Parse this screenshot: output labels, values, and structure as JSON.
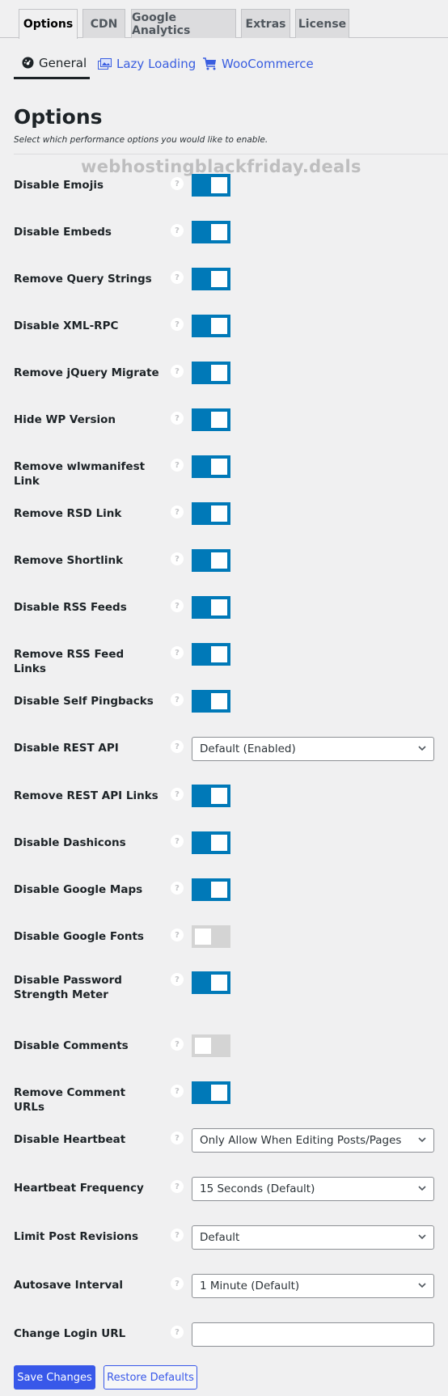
{
  "tabs": [
    {
      "label": "Options",
      "active": true
    },
    {
      "label": "CDN",
      "active": false
    },
    {
      "label": "Google Analytics",
      "active": false
    },
    {
      "label": "Extras",
      "active": false
    },
    {
      "label": "License",
      "active": false
    }
  ],
  "subtabs": [
    {
      "label": "General",
      "icon": "dashboard-icon",
      "active": true
    },
    {
      "label": "Lazy Loading",
      "icon": "images-icon",
      "active": false
    },
    {
      "label": "WooCommerce",
      "icon": "cart-icon",
      "active": false
    }
  ],
  "heading": "Options",
  "subtitle": "Select which performance options you would like to enable.",
  "watermark": "webhostingblackfriday.deals",
  "help_glyph": "?",
  "colors": {
    "toggle_on": "#0079b8",
    "toggle_off": "#d4d4d4",
    "primary": "#3858e9",
    "link": "#3a5ee0"
  },
  "options": [
    {
      "label": "Disable Emojis",
      "type": "toggle",
      "value": true
    },
    {
      "label": "Disable Embeds",
      "type": "toggle",
      "value": true
    },
    {
      "label": "Remove Query Strings",
      "type": "toggle",
      "value": true
    },
    {
      "label": "Disable XML-RPC",
      "type": "toggle",
      "value": true
    },
    {
      "label": "Remove jQuery Migrate",
      "type": "toggle",
      "value": true
    },
    {
      "label": "Hide WP Version",
      "type": "toggle",
      "value": true
    },
    {
      "label": "Remove wlwmanifest Link",
      "type": "toggle",
      "value": true
    },
    {
      "label": "Remove RSD Link",
      "type": "toggle",
      "value": true
    },
    {
      "label": "Remove Shortlink",
      "type": "toggle",
      "value": true
    },
    {
      "label": "Disable RSS Feeds",
      "type": "toggle",
      "value": true
    },
    {
      "label": "Remove RSS Feed Links",
      "type": "toggle",
      "value": true
    },
    {
      "label": "Disable Self Pingbacks",
      "type": "toggle",
      "value": true
    },
    {
      "label": "Disable REST API",
      "type": "select",
      "value": "Default (Enabled)"
    },
    {
      "label": "Remove REST API Links",
      "type": "toggle",
      "value": true
    },
    {
      "label": "Disable Dashicons",
      "type": "toggle",
      "value": true
    },
    {
      "label": "Disable Google Maps",
      "type": "toggle",
      "value": true
    },
    {
      "label": "Disable Google Fonts",
      "type": "toggle",
      "value": false
    },
    {
      "label": "Disable Password Strength Meter",
      "type": "toggle",
      "value": true
    },
    {
      "label": "Disable Comments",
      "type": "toggle",
      "value": false
    },
    {
      "label": "Remove Comment URLs",
      "type": "toggle",
      "value": true
    },
    {
      "label": "Disable Heartbeat",
      "type": "select",
      "value": "Only Allow When Editing Posts/Pages"
    },
    {
      "label": "Heartbeat Frequency",
      "type": "select",
      "value": "15 Seconds (Default)"
    },
    {
      "label": "Limit Post Revisions",
      "type": "select",
      "value": "Default"
    },
    {
      "label": "Autosave Interval",
      "type": "select",
      "value": "1 Minute (Default)"
    },
    {
      "label": "Change Login URL",
      "type": "text",
      "value": "",
      "placeholder": ""
    }
  ],
  "buttons": {
    "save": "Save Changes",
    "restore": "Restore Defaults"
  }
}
